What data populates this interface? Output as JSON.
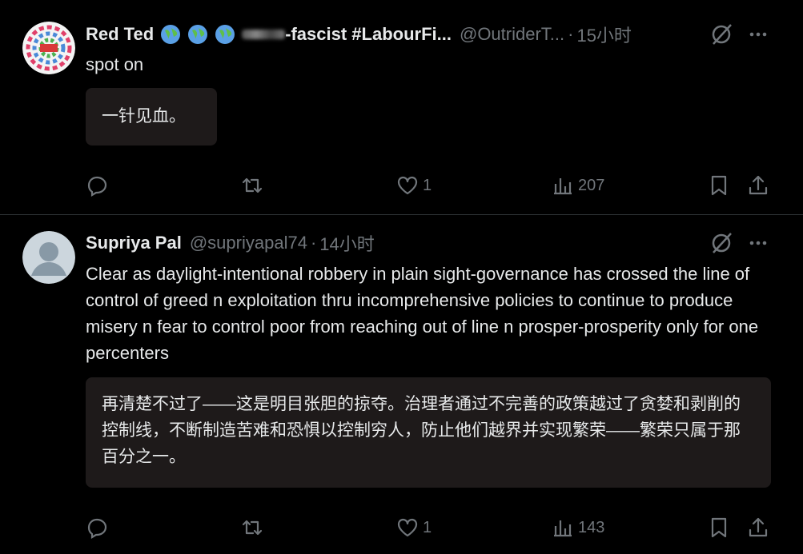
{
  "tweets": [
    {
      "name": "Red Ted",
      "name_suffix": "-fascist #LabourFi...",
      "handle": "@OutriderT...",
      "dot": "·",
      "time": "15小时",
      "text": "spot on",
      "translation": "一针见血。",
      "actions": {
        "reply": "",
        "retweet": "",
        "like": "1",
        "views": "207"
      }
    },
    {
      "name": "Supriya Pal",
      "handle": "@supriyapal74",
      "dot": "·",
      "time": "14小时",
      "text": "Clear as daylight-intentional robbery in plain sight-governance has crossed the line of control of greed n exploitation thru incomprehensive policies to continue to produce misery n fear to control poor from reaching out of line n prosper-prosperity only for one percenters",
      "translation": "再清楚不过了——这是明目张胆的掠夺。治理者通过不完善的政策越过了贪婪和剥削的控制线，不断制造苦难和恐惧以控制穷人，防止他们越界并实现繁荣——繁荣只属于那百分之一。",
      "actions": {
        "reply": "",
        "retweet": "",
        "like": "1",
        "views": "143"
      }
    }
  ],
  "icons": {
    "reply": "reply-icon",
    "retweet": "retweet-icon",
    "like": "heart-icon",
    "views": "views-icon",
    "bookmark": "bookmark-icon",
    "share": "share-icon",
    "grok": "grok-icon",
    "more": "more-icon"
  },
  "colors": {
    "background": "#000000",
    "text": "#e7e9ea",
    "muted": "#71767b",
    "translation_bg": "#1e1a1a",
    "divider": "#2f3336"
  }
}
